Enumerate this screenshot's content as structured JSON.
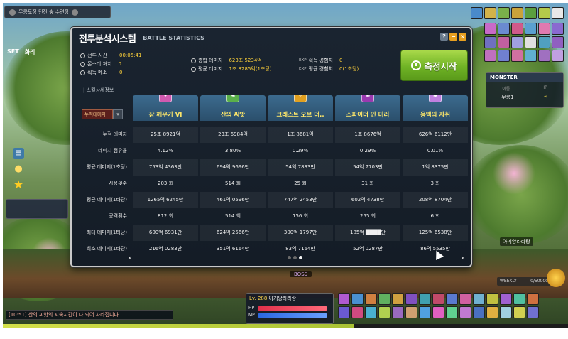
{
  "hud": {
    "top_left_text": "무릉도장 던전 숲 수련장",
    "chat_line": "[10:51] 산의 씨앗의 지속시간이 다 되어 사라집니다.",
    "player_name_tag": "아기앙라라랑",
    "boss_tag": "BOSS",
    "settings_label": "SET",
    "settings_extra": "화리",
    "char_level": "Lv. 288",
    "char_name": "아기앙라라랑",
    "hp_label": "HP",
    "mp_label": "MP",
    "weekly_label": "WEEKLY",
    "weekly_value": "0/50000",
    "monster_panel": {
      "title": "MONSTER",
      "col_name": "이름",
      "col_hp": "HP",
      "name": "무릉1",
      "hp": "∞"
    }
  },
  "window": {
    "title_ko": "전투분석시스템",
    "title_en": "BATTLE STATISTICS",
    "help_btn": "?",
    "min_btn": "−",
    "close_btn": "×",
    "summary": {
      "battle_time_label": "전투 시간",
      "battle_time_value": "00:05:41",
      "kills_label": "몬스터 처치",
      "kills_value": "0",
      "meso_label": "획득 메소",
      "meso_value": "0",
      "total_damage_label": "총합 데미지",
      "total_damage_value": "623조 5234억",
      "avg_damage_label": "평균 데미지",
      "avg_damage_value": "1조 8285억(1초당)",
      "exp_prefix": "EXP",
      "exp_gain_label": "획득 경험치",
      "exp_gain_value": "0",
      "exp_avg_label": "평균 경험치",
      "exp_avg_value": "0(1초당)"
    },
    "measure_button": "측정시작",
    "section_title": "| 스킬상세정보",
    "sort_label": "누적데미지",
    "sort_arrow": "▾",
    "row_labels": [
      "누적 데미지",
      "데미지 점유율",
      "평균 데미지(1초당)",
      "사용횟수",
      "평균 데미지(1타당)",
      "공격횟수",
      "최대 데미지(1타당)",
      "최소 데미지(1타당)"
    ],
    "skills": [
      {
        "name": "잠 깨우기 VI",
        "icon": "spark-icon",
        "icon_color": "#d05ab0",
        "values": [
          "25조 8921억",
          "4.12%",
          "753억 4363만",
          "203 회",
          "1265억 6245만",
          "812 회",
          "600억 6931만",
          "216억 0283만"
        ]
      },
      {
        "name": "산의 씨앗",
        "icon": "seed-icon",
        "icon_color": "#5ab04a",
        "values": [
          "23조 6984억",
          "3.80%",
          "694억 9696만",
          "514 회",
          "461억 0596만",
          "514 회",
          "624억 2566만",
          "351억 6164만"
        ]
      },
      {
        "name": "크레스트 오브 더..",
        "icon": "crest-icon",
        "icon_color": "#e0a020",
        "values": [
          "1조 8681억",
          "0.29%",
          "54억 7833만",
          "25 회",
          "747억 2453만",
          "156 회",
          "300억 1797만",
          "83억 7164만"
        ]
      },
      {
        "name": "스파이더 인 미러",
        "icon": "spider-icon",
        "icon_color": "#9a3ab0",
        "values": [
          "1조 8676억",
          "0.29%",
          "54억 7703만",
          "31 회",
          "602억 4738만",
          "255 회",
          "185억 ████만",
          "52억 0287만"
        ]
      },
      {
        "name": "용맥의 자취",
        "icon": "dragon-icon",
        "icon_color": "#c080e0",
        "values": [
          "626억 6112만",
          "0.01%",
          "1억 8375만",
          "3 회",
          "208억 8704만",
          "6 회",
          "125억 6538만",
          "86억 5535만"
        ]
      }
    ],
    "nav_prev": "‹",
    "nav_next": "›",
    "pages": 3,
    "current_page": 3
  },
  "colors": {
    "accent_value": "#ffd23a",
    "skill_name": "#ffe86a",
    "measure_green": "#6fb325",
    "header_blue": "#2b4f6c"
  }
}
